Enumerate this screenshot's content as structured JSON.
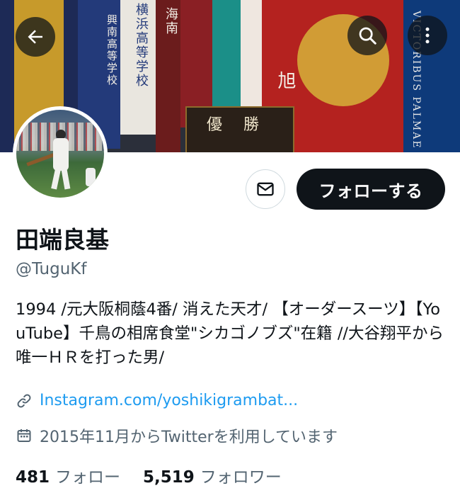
{
  "banner": {
    "flag_texts": [
      "横浜高等学校",
      "興南高等学校",
      "海南",
      "旭"
    ],
    "plaque_text": "優勝",
    "right_text": "VICTORIBUS PALMAE"
  },
  "nav": {
    "back_icon": "arrow-left-icon",
    "search_icon": "search-icon",
    "more_icon": "more-vertical-icon"
  },
  "profile": {
    "display_name": "田端良基",
    "handle": "@TuguKf",
    "bio": "1994 /元大阪桐蔭4番/ 消えた天才/ 【オーダースーツ】【YouTube】千鳥の相席食堂\"シカゴノブズ\"在籍 //大谷翔平から唯一ＨＲを打った男/",
    "link_text": "Instagram.com/yoshikigrambat...",
    "joined_text": "2015年11月からTwitterを利用しています",
    "following_count": "481",
    "following_label": "フォロー",
    "followers_count": "5,519",
    "followers_label": "フォロワー"
  },
  "actions": {
    "message_icon": "envelope-icon",
    "follow_label": "フォローする"
  },
  "colors": {
    "accent": "#1d9bf0",
    "button_dark": "#0f1419",
    "secondary_text": "#536471"
  }
}
